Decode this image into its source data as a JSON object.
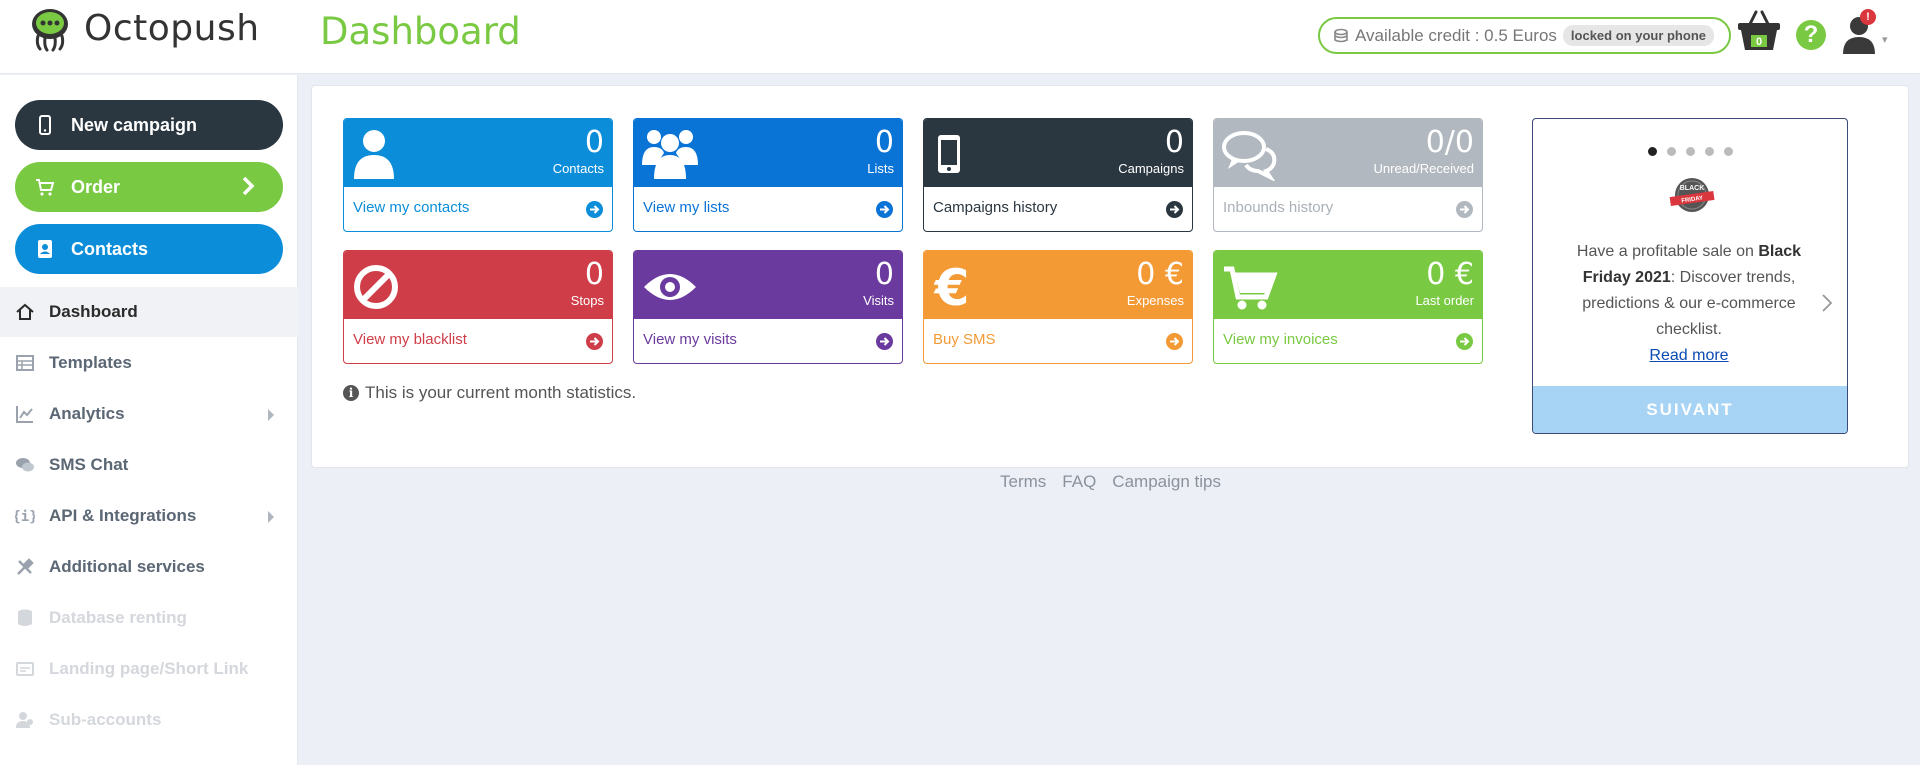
{
  "header": {
    "brand": "Octopush",
    "title": "Dashboard",
    "credit_text": "Available credit : 0.5 Euros",
    "credit_badge": "locked on your phone",
    "basket_count": "0",
    "help_symbol": "?",
    "notif_count": "!"
  },
  "sidebar": {
    "pills": {
      "new_campaign": "New campaign",
      "order": "Order",
      "contacts": "Contacts"
    },
    "items": [
      {
        "label": "Dashboard"
      },
      {
        "label": "Templates"
      },
      {
        "label": "Analytics"
      },
      {
        "label": "SMS Chat"
      },
      {
        "label": "API & Integrations"
      },
      {
        "label": "Additional services"
      },
      {
        "label": "Database renting"
      },
      {
        "label": "Landing page/Short Link"
      },
      {
        "label": "Sub-accounts"
      }
    ]
  },
  "tiles": [
    {
      "value": "0",
      "label": "Contacts",
      "link": "View my contacts",
      "color": "#0b8dd9",
      "icon": "user-icon"
    },
    {
      "value": "0",
      "label": "Lists",
      "link": "View my lists",
      "color": "#0a73d6",
      "icon": "users-group-icon"
    },
    {
      "value": "0",
      "label": "Campaigns",
      "link": "Campaigns history",
      "color": "#2a3640",
      "icon": "mobile-icon"
    },
    {
      "value": "0/0",
      "label": "Unread/Received",
      "link": "Inbounds history",
      "color": "#b2b8bf",
      "icon": "chat-bubbles-icon"
    },
    {
      "value": "0",
      "label": "Stops",
      "link": "View my blacklist",
      "color": "#cf3e48",
      "icon": "ban-icon"
    },
    {
      "value": "0",
      "label": "Visits",
      "link": "View my visits",
      "color": "#6b3a9e",
      "icon": "eye-icon"
    },
    {
      "value": "0 €",
      "label": "Expenses",
      "link": "Buy SMS",
      "color": "#f39a35",
      "icon": "euro-icon"
    },
    {
      "value": "0 €",
      "label": "Last order",
      "link": "View my invoices",
      "color": "#7ac943",
      "icon": "cart-icon"
    }
  ],
  "note": "This is your current month statistics.",
  "carousel": {
    "text_before": "Have a profitable sale on ",
    "text_bold": "Black Friday 2021",
    "text_after": ": Discover trends, predictions & our e-commerce checklist.",
    "read_more": "Read more",
    "button": "SUIVANT",
    "slides_total": 5,
    "active_slide": 1,
    "badge_top": "BLACK",
    "badge_bottom": "FRIDAY"
  },
  "footer": {
    "links": [
      "Terms",
      "FAQ",
      "Campaign tips"
    ]
  }
}
